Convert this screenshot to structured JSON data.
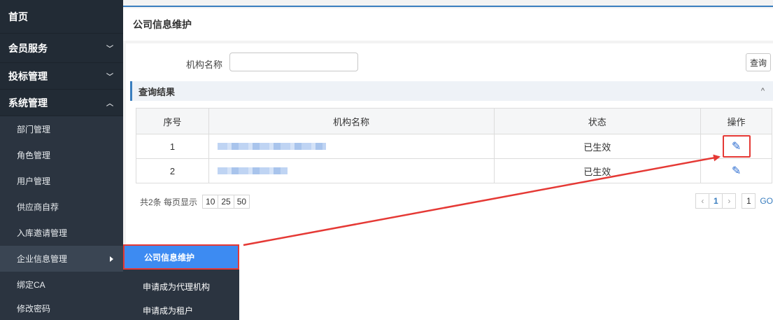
{
  "sidebar": {
    "home": "首页",
    "menus": [
      {
        "label": "会员服务",
        "chevron": "﹀"
      },
      {
        "label": "投标管理",
        "chevron": "﹀"
      },
      {
        "label": "系统管理",
        "chevron": "︿"
      }
    ],
    "sub_items": [
      "部门管理",
      "角色管理",
      "用户管理",
      "供应商自荐",
      "入库邀请管理",
      "企业信息管理",
      "绑定CA",
      "修改密码"
    ]
  },
  "flyout": {
    "items": [
      "公司信息维护",
      "申请成为代理机构",
      "申请成为租户"
    ]
  },
  "page": {
    "title": "公司信息维护"
  },
  "search": {
    "label": "机构名称",
    "value": "",
    "button": "查询"
  },
  "results": {
    "title": "查询结果",
    "collapse_icon": "^",
    "columns": [
      "序号",
      "机构名称",
      "状态",
      "操作"
    ],
    "rows": [
      {
        "index": "1",
        "name": "",
        "status": "已生效"
      },
      {
        "index": "2",
        "name": "",
        "status": "已生效"
      }
    ]
  },
  "pagination": {
    "summary": "共2条 每页显示",
    "sizes": [
      "10",
      "25",
      "50"
    ],
    "prev": "‹",
    "current": "1",
    "next": "›",
    "goto_value": "1",
    "go": "GO"
  },
  "colors": {
    "sidebar_bg": "#2b3440",
    "accent": "#3a7ebf",
    "active_flyout": "#3d8bf2",
    "annotation": "#e53935"
  },
  "icons": {
    "edit": "pencil-icon",
    "expand": "chevron-down-icon",
    "collapse": "chevron-up-icon",
    "submenu": "caret-right-icon"
  }
}
